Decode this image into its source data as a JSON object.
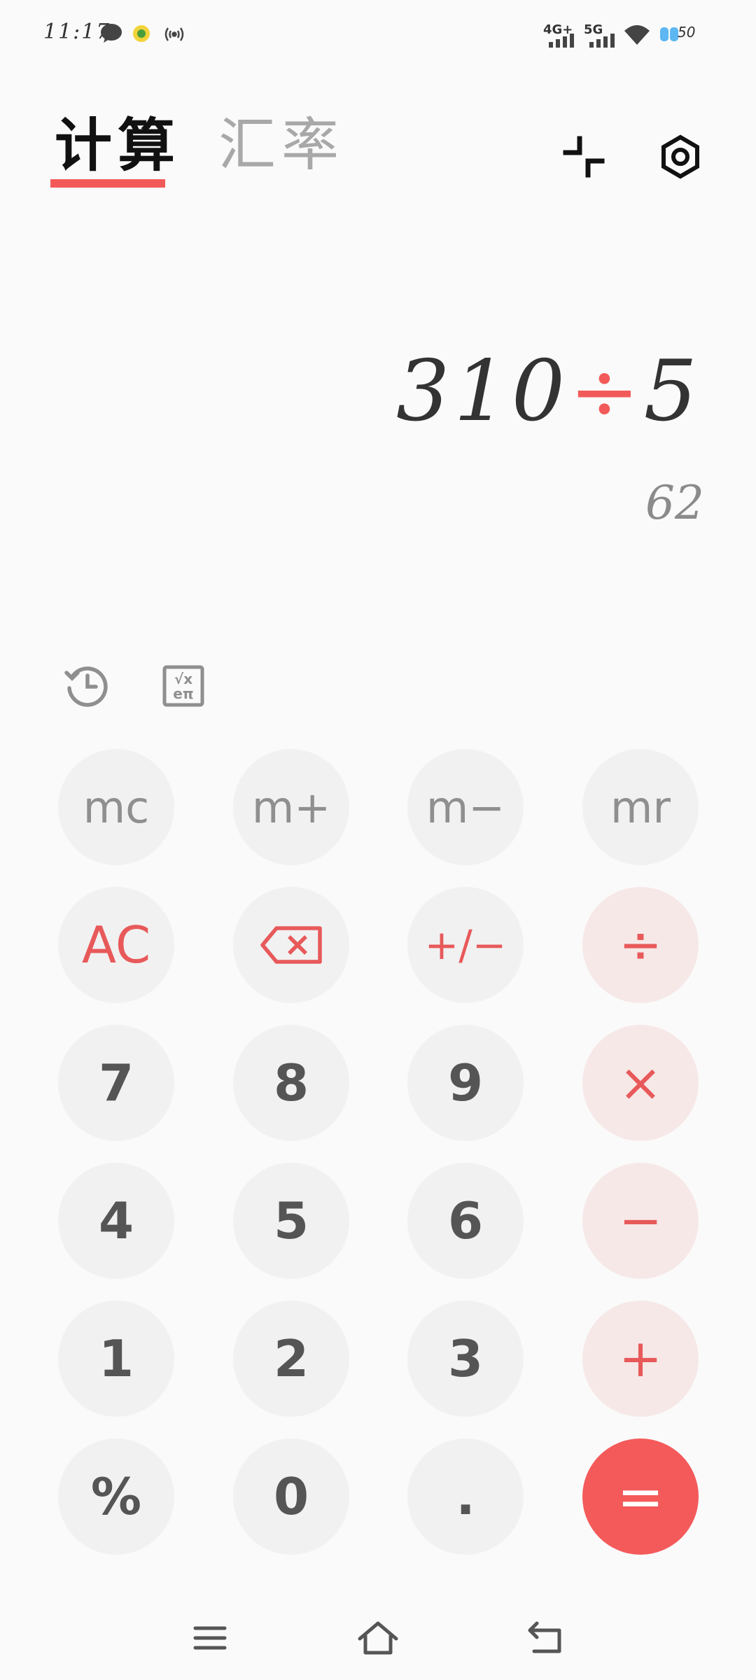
{
  "status_bar": {
    "time": "11:17",
    "net1": "4G+",
    "net2": "5G",
    "battery": "50"
  },
  "header": {
    "tab_calc": "计算",
    "tab_rate": "汇率"
  },
  "display": {
    "expression_left": "310",
    "operator": "÷",
    "expression_right": "5",
    "result": "62"
  },
  "keys": {
    "mc": "mc",
    "mplus": "m+",
    "mminus": "m−",
    "mr": "mr",
    "ac": "AC",
    "sign": "+/−",
    "divide": "÷",
    "seven": "7",
    "eight": "8",
    "nine": "9",
    "multiply": "×",
    "four": "4",
    "five": "5",
    "six": "6",
    "minus": "−",
    "one": "1",
    "two": "2",
    "three": "3",
    "plus": "+",
    "percent": "%",
    "zero": "0",
    "dot": ".",
    "equals": "="
  },
  "colors": {
    "accent": "#f25a59",
    "key_bg": "#f1f1f1",
    "op_bg": "#f7e8e8"
  }
}
